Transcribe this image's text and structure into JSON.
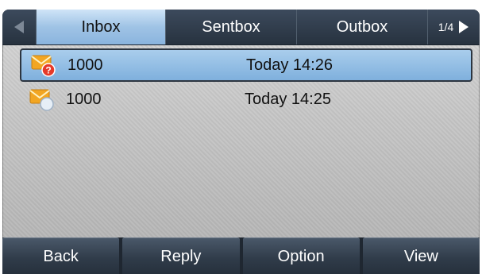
{
  "tabs": {
    "prev_icon": "left-arrow-icon",
    "items": [
      {
        "label": "Inbox",
        "active": true
      },
      {
        "label": "Sentbox",
        "active": false
      },
      {
        "label": "Outbox",
        "active": false
      }
    ],
    "page": "1/4",
    "next_icon": "right-arrow-icon"
  },
  "messages": [
    {
      "icon": "unread-message-icon",
      "number": "1000",
      "time": "Today 14:26",
      "selected": true
    },
    {
      "icon": "read-message-icon",
      "number": "1000",
      "time": "Today 14:25",
      "selected": false
    }
  ],
  "softkeys": {
    "back": "Back",
    "reply": "Reply",
    "option": "Option",
    "view": "View"
  },
  "colors": {
    "tabbar": "#2f3b4a",
    "active_tab": "#a9cdec",
    "selected_row": "#8ab4de",
    "envelope": "#f2a623",
    "unread_badge": "#e53a2a"
  }
}
